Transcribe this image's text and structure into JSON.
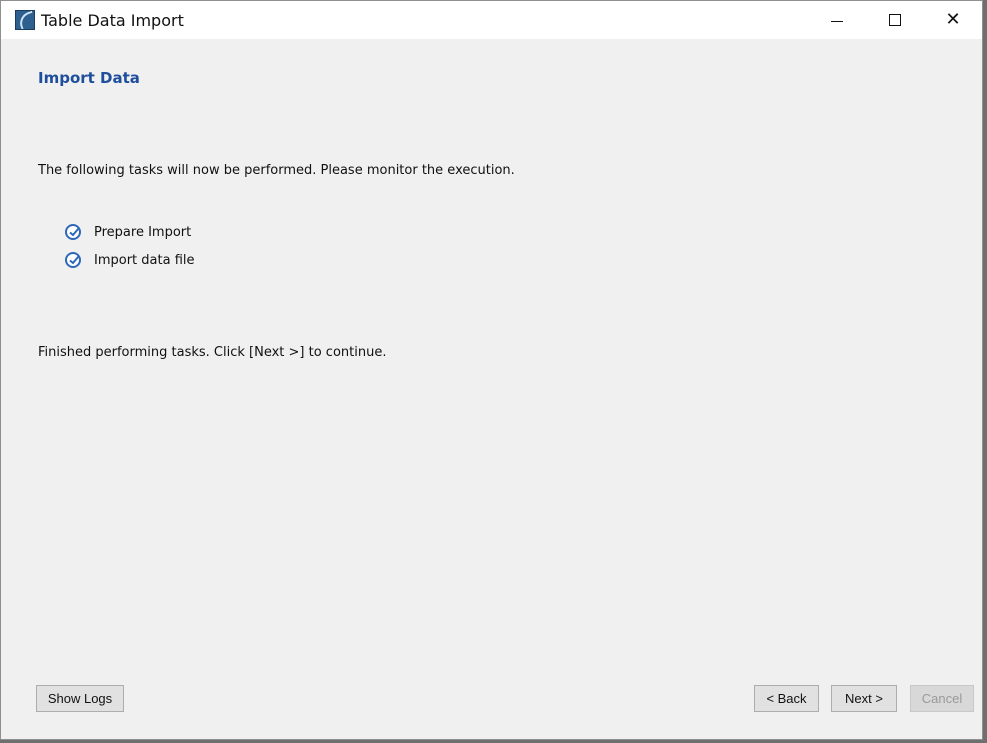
{
  "window": {
    "title": "Table Data Import",
    "controls": {
      "minimize": "minimize-icon",
      "maximize": "maximize-icon",
      "close": "close-icon"
    }
  },
  "page": {
    "header": "Import Data",
    "description": "The following tasks will now be performed. Please monitor the execution.",
    "tasks": [
      {
        "label": "Prepare Import",
        "status": "done",
        "icon": "check-circle-icon"
      },
      {
        "label": "Import data file",
        "status": "done",
        "icon": "check-circle-icon"
      }
    ],
    "finished_message": "Finished performing tasks. Click [Next >] to continue."
  },
  "buttons": {
    "show_logs": "Show Logs",
    "back": "< Back",
    "next": "Next >",
    "cancel": "Cancel"
  },
  "colors": {
    "header_text": "#1f4e9c",
    "check_icon": "#2f67b8",
    "window_bg": "#f0f0f0"
  }
}
